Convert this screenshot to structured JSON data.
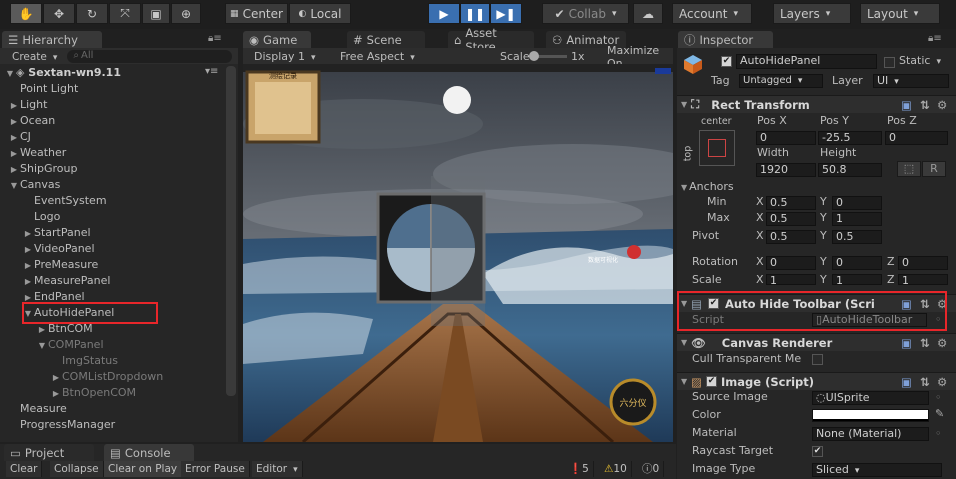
{
  "toolbar": {
    "tools": [
      "hand-icon",
      "move-icon",
      "rotate-icon",
      "scale-icon",
      "rect-icon",
      "transform-icon"
    ],
    "center_label": "Center",
    "local_label": "Local",
    "collab_label": "Collab",
    "account_label": "Account",
    "layers_label": "Layers",
    "layout_label": "Layout"
  },
  "hierarchy": {
    "tab_label": "Hierarchy",
    "create_label": "Create",
    "search_placeholder": "All",
    "scene_name": "Sextan-wn9.11",
    "items": [
      {
        "label": "Point Light",
        "depth": 1,
        "tri": ""
      },
      {
        "label": "Light",
        "depth": 1,
        "tri": "▶"
      },
      {
        "label": "Ocean",
        "depth": 1,
        "tri": "▶"
      },
      {
        "label": "CJ",
        "depth": 1,
        "tri": "▶"
      },
      {
        "label": "Weather",
        "depth": 1,
        "tri": "▶"
      },
      {
        "label": "ShipGroup",
        "depth": 1,
        "tri": "▶"
      },
      {
        "label": "Canvas",
        "depth": 1,
        "tri": "▼"
      },
      {
        "label": "EventSystem",
        "depth": 2,
        "tri": ""
      },
      {
        "label": "Logo",
        "depth": 2,
        "tri": ""
      },
      {
        "label": "StartPanel",
        "depth": 2,
        "tri": "▶"
      },
      {
        "label": "VideoPanel",
        "depth": 2,
        "tri": "▶"
      },
      {
        "label": "PreMeasure",
        "depth": 2,
        "tri": "▶"
      },
      {
        "label": "MeasurePanel",
        "depth": 2,
        "tri": "▶"
      },
      {
        "label": "EndPanel",
        "depth": 2,
        "tri": "▶"
      },
      {
        "label": "AutoHidePanel",
        "depth": 2,
        "tri": "▼"
      },
      {
        "label": "BtnCOM",
        "depth": 3,
        "tri": "▶"
      },
      {
        "label": "COMPanel",
        "depth": 3,
        "tri": "▼"
      },
      {
        "label": "ImgStatus",
        "depth": 4,
        "tri": ""
      },
      {
        "label": "COMListDropdown",
        "depth": 4,
        "tri": "▶"
      },
      {
        "label": "BtnOpenCOM",
        "depth": 4,
        "tri": "▶"
      },
      {
        "label": "Measure",
        "depth": 1,
        "tri": ""
      },
      {
        "label": "ProgressManager",
        "depth": 1,
        "tri": ""
      }
    ]
  },
  "center_tabs": {
    "game": "Game",
    "scene": "Scene",
    "asset_store": "Asset Store",
    "animator": "Animator"
  },
  "game_bar": {
    "display": "Display 1",
    "aspect": "Free Aspect",
    "scale_label": "Scale",
    "scale_value": "1x",
    "maximize": "Maximize On"
  },
  "game_view": {
    "sign_text": "测绘记录",
    "label_text": "数据可视化",
    "logo_text": "六分仪"
  },
  "console": {
    "project_tab": "Project",
    "console_tab": "Console",
    "buttons": [
      "Clear",
      "Collapse",
      "Clear on Play",
      "Error Pause",
      "Editor"
    ],
    "errors": "5",
    "warnings": "10",
    "logs": "0"
  },
  "inspector": {
    "tab_label": "Inspector",
    "object_name": "AutoHidePanel",
    "static_label": "Static",
    "tag_label": "Tag",
    "tag_value": "Untagged",
    "layer_label": "Layer",
    "layer_value": "UI",
    "rect_transform": {
      "title": "Rect Transform",
      "anchor_preset_h": "center",
      "anchor_preset_v": "top",
      "posx_label": "Pos X",
      "posy_label": "Pos Y",
      "posz_label": "Pos Z",
      "posx": "0",
      "posy": "-25.5",
      "posz": "0",
      "width_label": "Width",
      "height_label": "Height",
      "width": "1920",
      "height": "50.8",
      "r_button": "R",
      "anchors_label": "Anchors",
      "min_label": "Min",
      "max_label": "Max",
      "pivot_label": "Pivot",
      "min_x": "0.5",
      "min_y": "0",
      "max_x": "0.5",
      "max_y": "1",
      "pivot_x": "0.5",
      "pivot_y": "0.5",
      "rotation_label": "Rotation",
      "rot_x": "0",
      "rot_y": "0",
      "rot_z": "0",
      "scale_label": "Scale",
      "scale_x": "1",
      "scale_y": "1",
      "scale_z": "1",
      "x_label": "X",
      "y_label": "Y",
      "z_label": "Z"
    },
    "auto_hide": {
      "title": "Auto Hide Toolbar (Scri",
      "script_label": "Script",
      "script_value": "AutoHideToolbar"
    },
    "canvas_renderer": {
      "title": "Canvas Renderer",
      "cull_label": "Cull Transparent Me"
    },
    "image": {
      "title": "Image (Script)",
      "source_label": "Source Image",
      "source_value": "UISprite",
      "color_label": "Color",
      "material_label": "Material",
      "material_value": "None (Material)",
      "raycast_label": "Raycast Target",
      "type_label": "Image Type",
      "type_value": "Sliced"
    }
  },
  "colors": {
    "accent": "#3a6fb0",
    "highlight_box": "#e8262a",
    "selection": "#3e5f96"
  }
}
